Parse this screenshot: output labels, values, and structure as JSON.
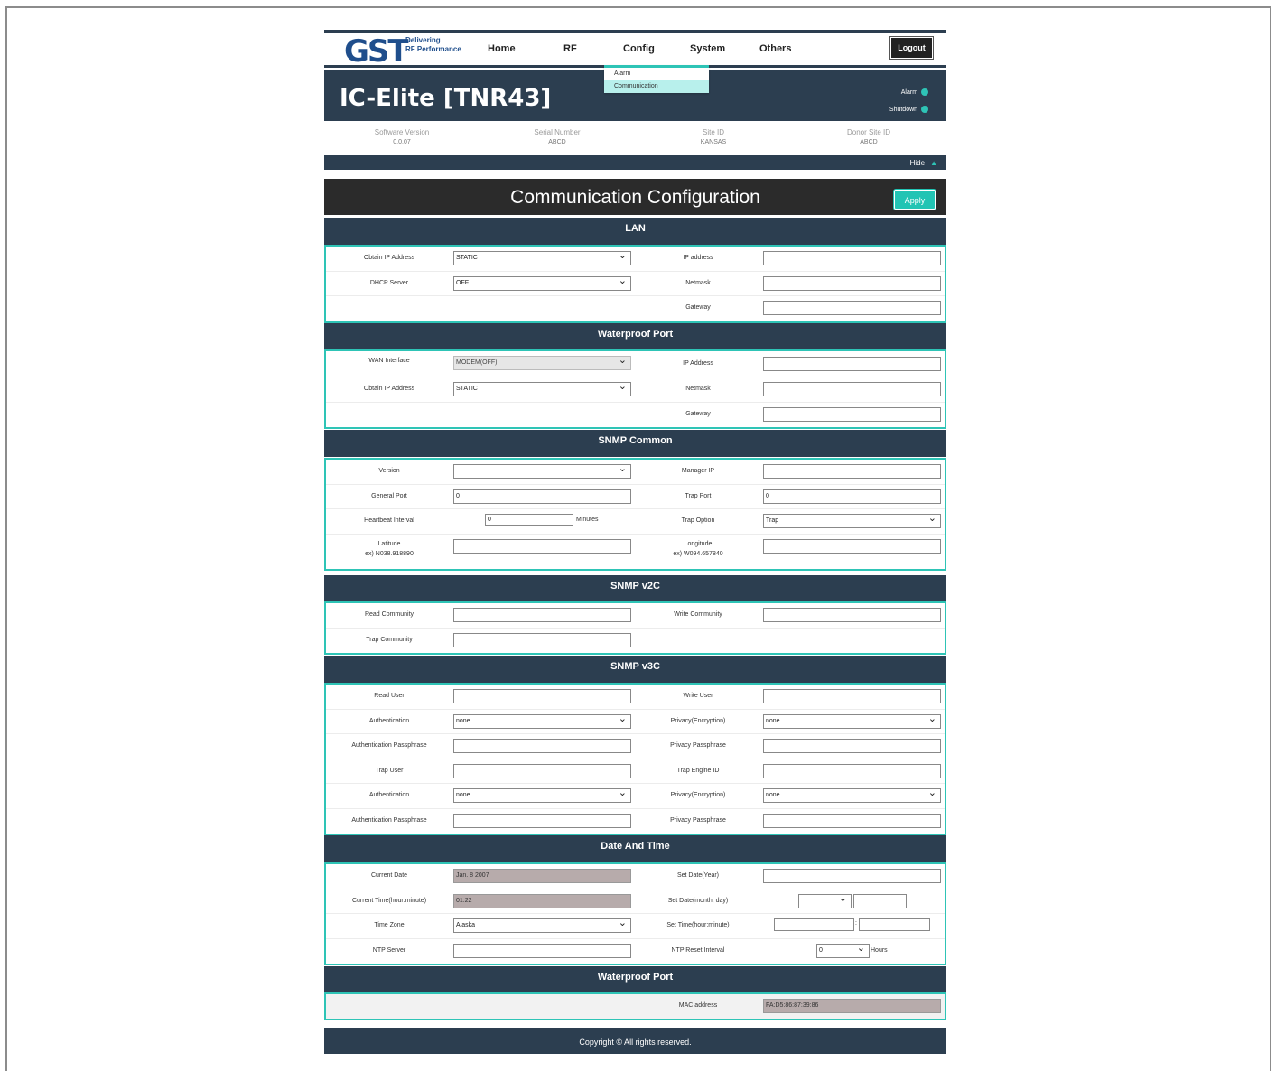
{
  "logo": {
    "brand": "GST",
    "tagline_1": "Delivering",
    "tagline_2": "RF Performance"
  },
  "nav": {
    "home": "Home",
    "rf": "RF",
    "config": "Config",
    "system": "System",
    "others": "Others",
    "logout": "Logout"
  },
  "config_menu": {
    "alarm": "Alarm",
    "communication": "Communication"
  },
  "header": {
    "device_title": "IC-Elite [TNR43]",
    "alarm_label": "Alarm",
    "shutdown_label": "Shutdown"
  },
  "info": {
    "software_version_label": "Software Version",
    "software_version": "0.0.07",
    "serial_number_label": "Serial Number",
    "serial_number": "ABCD",
    "site_id_label": "Site ID",
    "site_id": "KANSAS",
    "donor_site_id_label": "Donor Site ID",
    "donor_site_id": "ABCD",
    "hide_label": "Hide"
  },
  "page": {
    "title": "Communication Configuration",
    "apply": "Apply"
  },
  "lan": {
    "title": "LAN",
    "obtain_ip_label": "Obtain IP Address",
    "obtain_ip_value": "STATIC",
    "dhcp_label": "DHCP Server",
    "dhcp_value": "OFF",
    "ip_label": "IP address",
    "ip_value": "",
    "netmask_label": "Netmask",
    "netmask_value": "",
    "gateway_label": "Gateway",
    "gateway_value": ""
  },
  "waterproof": {
    "title": "Waterproof Port",
    "wan_label": "WAN Interface",
    "wan_value": "MODEM(OFF)",
    "obtain_ip_label": "Obtain IP Address",
    "obtain_ip_value": "STATIC",
    "ip_label": "IP Address",
    "netmask_label": "Netmask",
    "gateway_label": "Gateway"
  },
  "snmp_common": {
    "title": "SNMP Common",
    "version_label": "Version",
    "version_value": "",
    "manager_ip_label": "Manager IP",
    "general_port_label": "General Port",
    "general_port_value": "0",
    "trap_port_label": "Trap Port",
    "trap_port_value": "0",
    "heartbeat_label": "Heartbeat Interval",
    "heartbeat_value": "0",
    "heartbeat_unit": "Minutes",
    "trap_option_label": "Trap Option",
    "trap_option_value": "Trap",
    "latitude_label": "Latitude",
    "latitude_example": "ex) N038.918890",
    "longitude_label": "Longitude",
    "longitude_example": "ex) W094.657840"
  },
  "snmp_v2c": {
    "title": "SNMP v2C",
    "read_community_label": "Read Community",
    "write_community_label": "Write Community",
    "trap_community_label": "Trap Community"
  },
  "snmp_v3c": {
    "title": "SNMP v3C",
    "read_user_label": "Read User",
    "write_user_label": "Write User",
    "auth_label": "Authentication",
    "auth_value": "none",
    "privacy_label": "Privacy(Encryption)",
    "privacy_value": "none",
    "auth_pass_label": "Authentication Passphrase",
    "privacy_pass_label": "Privacy Passphrase",
    "trap_user_label": "Trap User",
    "trap_engine_label": "Trap Engine ID",
    "trap_auth_label": "Authentication",
    "trap_auth_value": "none",
    "trap_privacy_label": "Privacy(Encryption)",
    "trap_privacy_value": "none",
    "trap_auth_pass_label": "Authentication Passphrase",
    "trap_privacy_pass_label": "Privacy Passphrase"
  },
  "datetime": {
    "title": "Date And Time",
    "current_date_label": "Current Date",
    "current_date_value": "Jan. 8 2007",
    "set_year_label": "Set Date(Year)",
    "current_time_label": "Current Time(hour:minute)",
    "current_time_value": "01:22",
    "set_month_day_label": "Set Date(month, day)",
    "timezone_label": "Time Zone",
    "timezone_value": "Alaska",
    "set_time_label": "Set Time(hour:minute)",
    "time_separator": ":",
    "ntp_label": "NTP Server",
    "ntp_reset_label": "NTP Reset Interval",
    "ntp_reset_value": "0",
    "ntp_reset_unit": "Hours"
  },
  "waterproof_mac": {
    "title": "Waterproof Port",
    "mac_label": "MAC address",
    "mac_value": "FA:D5:86:87:39:86"
  },
  "footer": {
    "copyright": "Copyright © All rights reserved."
  },
  "colors": {
    "navy": "#2c3e50",
    "teal": "#2ec4b6",
    "dark": "#2b2b2b"
  }
}
